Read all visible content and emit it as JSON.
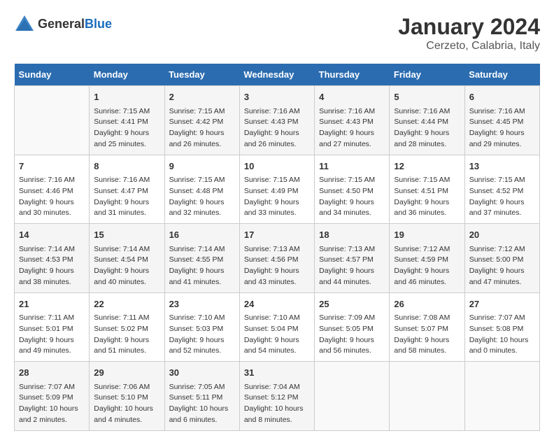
{
  "header": {
    "logo_general": "General",
    "logo_blue": "Blue",
    "month": "January 2024",
    "location": "Cerzeto, Calabria, Italy"
  },
  "weekdays": [
    "Sunday",
    "Monday",
    "Tuesday",
    "Wednesday",
    "Thursday",
    "Friday",
    "Saturday"
  ],
  "weeks": [
    [
      {
        "day": "",
        "info": ""
      },
      {
        "day": "1",
        "info": "Sunrise: 7:15 AM\nSunset: 4:41 PM\nDaylight: 9 hours\nand 25 minutes."
      },
      {
        "day": "2",
        "info": "Sunrise: 7:15 AM\nSunset: 4:42 PM\nDaylight: 9 hours\nand 26 minutes."
      },
      {
        "day": "3",
        "info": "Sunrise: 7:16 AM\nSunset: 4:43 PM\nDaylight: 9 hours\nand 26 minutes."
      },
      {
        "day": "4",
        "info": "Sunrise: 7:16 AM\nSunset: 4:43 PM\nDaylight: 9 hours\nand 27 minutes."
      },
      {
        "day": "5",
        "info": "Sunrise: 7:16 AM\nSunset: 4:44 PM\nDaylight: 9 hours\nand 28 minutes."
      },
      {
        "day": "6",
        "info": "Sunrise: 7:16 AM\nSunset: 4:45 PM\nDaylight: 9 hours\nand 29 minutes."
      }
    ],
    [
      {
        "day": "7",
        "info": "Sunrise: 7:16 AM\nSunset: 4:46 PM\nDaylight: 9 hours\nand 30 minutes."
      },
      {
        "day": "8",
        "info": "Sunrise: 7:16 AM\nSunset: 4:47 PM\nDaylight: 9 hours\nand 31 minutes."
      },
      {
        "day": "9",
        "info": "Sunrise: 7:15 AM\nSunset: 4:48 PM\nDaylight: 9 hours\nand 32 minutes."
      },
      {
        "day": "10",
        "info": "Sunrise: 7:15 AM\nSunset: 4:49 PM\nDaylight: 9 hours\nand 33 minutes."
      },
      {
        "day": "11",
        "info": "Sunrise: 7:15 AM\nSunset: 4:50 PM\nDaylight: 9 hours\nand 34 minutes."
      },
      {
        "day": "12",
        "info": "Sunrise: 7:15 AM\nSunset: 4:51 PM\nDaylight: 9 hours\nand 36 minutes."
      },
      {
        "day": "13",
        "info": "Sunrise: 7:15 AM\nSunset: 4:52 PM\nDaylight: 9 hours\nand 37 minutes."
      }
    ],
    [
      {
        "day": "14",
        "info": "Sunrise: 7:14 AM\nSunset: 4:53 PM\nDaylight: 9 hours\nand 38 minutes."
      },
      {
        "day": "15",
        "info": "Sunrise: 7:14 AM\nSunset: 4:54 PM\nDaylight: 9 hours\nand 40 minutes."
      },
      {
        "day": "16",
        "info": "Sunrise: 7:14 AM\nSunset: 4:55 PM\nDaylight: 9 hours\nand 41 minutes."
      },
      {
        "day": "17",
        "info": "Sunrise: 7:13 AM\nSunset: 4:56 PM\nDaylight: 9 hours\nand 43 minutes."
      },
      {
        "day": "18",
        "info": "Sunrise: 7:13 AM\nSunset: 4:57 PM\nDaylight: 9 hours\nand 44 minutes."
      },
      {
        "day": "19",
        "info": "Sunrise: 7:12 AM\nSunset: 4:59 PM\nDaylight: 9 hours\nand 46 minutes."
      },
      {
        "day": "20",
        "info": "Sunrise: 7:12 AM\nSunset: 5:00 PM\nDaylight: 9 hours\nand 47 minutes."
      }
    ],
    [
      {
        "day": "21",
        "info": "Sunrise: 7:11 AM\nSunset: 5:01 PM\nDaylight: 9 hours\nand 49 minutes."
      },
      {
        "day": "22",
        "info": "Sunrise: 7:11 AM\nSunset: 5:02 PM\nDaylight: 9 hours\nand 51 minutes."
      },
      {
        "day": "23",
        "info": "Sunrise: 7:10 AM\nSunset: 5:03 PM\nDaylight: 9 hours\nand 52 minutes."
      },
      {
        "day": "24",
        "info": "Sunrise: 7:10 AM\nSunset: 5:04 PM\nDaylight: 9 hours\nand 54 minutes."
      },
      {
        "day": "25",
        "info": "Sunrise: 7:09 AM\nSunset: 5:05 PM\nDaylight: 9 hours\nand 56 minutes."
      },
      {
        "day": "26",
        "info": "Sunrise: 7:08 AM\nSunset: 5:07 PM\nDaylight: 9 hours\nand 58 minutes."
      },
      {
        "day": "27",
        "info": "Sunrise: 7:07 AM\nSunset: 5:08 PM\nDaylight: 10 hours\nand 0 minutes."
      }
    ],
    [
      {
        "day": "28",
        "info": "Sunrise: 7:07 AM\nSunset: 5:09 PM\nDaylight: 10 hours\nand 2 minutes."
      },
      {
        "day": "29",
        "info": "Sunrise: 7:06 AM\nSunset: 5:10 PM\nDaylight: 10 hours\nand 4 minutes."
      },
      {
        "day": "30",
        "info": "Sunrise: 7:05 AM\nSunset: 5:11 PM\nDaylight: 10 hours\nand 6 minutes."
      },
      {
        "day": "31",
        "info": "Sunrise: 7:04 AM\nSunset: 5:12 PM\nDaylight: 10 hours\nand 8 minutes."
      },
      {
        "day": "",
        "info": ""
      },
      {
        "day": "",
        "info": ""
      },
      {
        "day": "",
        "info": ""
      }
    ]
  ]
}
